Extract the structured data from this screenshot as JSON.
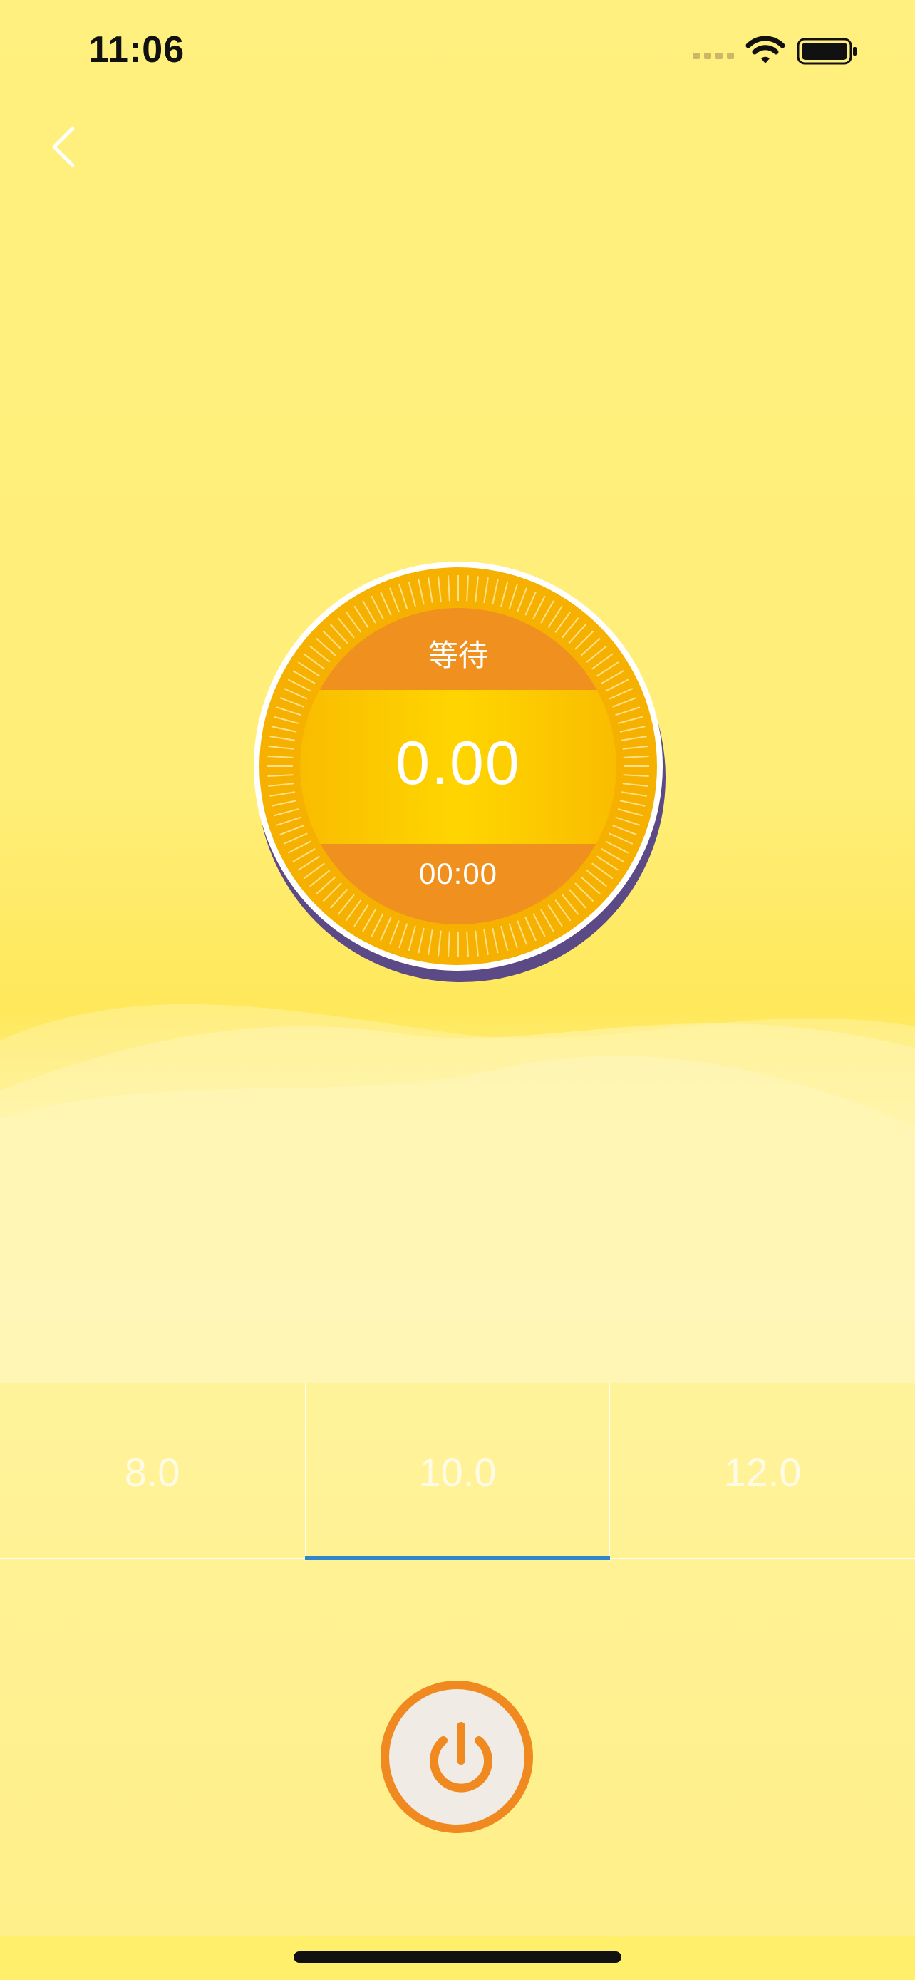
{
  "status_bar": {
    "time": "11:06"
  },
  "icons": {
    "back": "chevron-left-icon",
    "signal": "signal-icon",
    "wifi": "wifi-icon",
    "battery": "battery-icon",
    "power": "power-icon"
  },
  "dial": {
    "status": "等待",
    "value": "0.00",
    "time": "00:00"
  },
  "tabs": [
    {
      "label": "8.0"
    },
    {
      "label": "10.0"
    },
    {
      "label": "12.0"
    }
  ],
  "selected_tab_label": "10.0",
  "colors": {
    "background": "#fff07f",
    "dial_orange": "#f0901e",
    "dial_gold": "#fcc400",
    "tab_indicator": "#2f86c8",
    "power_ring": "#f0891f",
    "power_face": "#f0ebe4"
  }
}
